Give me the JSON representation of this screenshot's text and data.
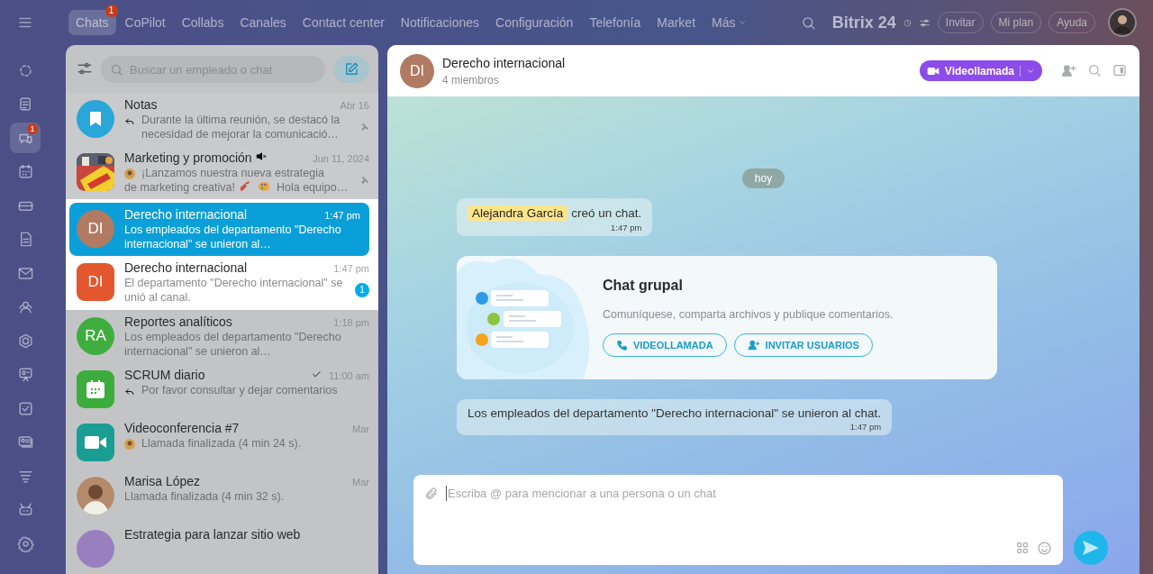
{
  "top_nav": {
    "items": [
      {
        "label": "Chats",
        "selected": true,
        "badge": "1",
        "dropdown": false
      },
      {
        "label": "CoPilot",
        "selected": false,
        "dropdown": false
      },
      {
        "label": "Collabs",
        "selected": false,
        "dropdown": false
      },
      {
        "label": "Canales",
        "selected": false,
        "dropdown": false
      },
      {
        "label": "Contact center",
        "selected": false,
        "dropdown": false
      },
      {
        "label": "Notificaciones",
        "selected": false,
        "dropdown": false
      },
      {
        "label": "Configuración",
        "selected": false,
        "dropdown": false
      },
      {
        "label": "Telefonía",
        "selected": false,
        "dropdown": false
      },
      {
        "label": "Market",
        "selected": false,
        "dropdown": false
      },
      {
        "label": "Más",
        "selected": false,
        "dropdown": true
      }
    ],
    "brand": "Bitrix 24",
    "buttons": [
      "Invitar",
      "Mi plan",
      "Ayuda"
    ]
  },
  "sidebar": {
    "items": [
      {
        "selected": false
      },
      {
        "selected": false
      },
      {
        "selected": true,
        "badge": "1"
      },
      {
        "selected": false
      },
      {
        "selected": false
      },
      {
        "selected": false
      },
      {
        "selected": false
      },
      {
        "selected": false
      },
      {
        "selected": false
      },
      {
        "selected": false
      },
      {
        "selected": false
      },
      {
        "selected": false
      },
      {
        "selected": false
      },
      {
        "selected": false
      },
      {
        "selected": false
      }
    ]
  },
  "chat_list": {
    "search": {
      "placeholder": "Buscar un empleado o chat"
    },
    "sections": [
      {
        "spotlit": false,
        "items": [
          {
            "title": "Notas",
            "time": "Abr 16",
            "preview": "Durante la última reunión, se destacó la necesidad de mejorar la comunicació…",
            "avatar": {
              "kind": "bookmark",
              "color": "#2aa6d9"
            },
            "reply": true,
            "pinned": true,
            "selected": false
          },
          {
            "title": "Marketing y promoción",
            "time": "Jun 11, 2024",
            "preview": "¡Lanzamos nuestra nueva estrategia",
            "preview_2": "de marketing creativa!",
            "preview_tail": "Hola equipo…",
            "sender_avatar": true,
            "pinned": true,
            "muted": true,
            "selected": false
          }
        ]
      },
      {
        "spotlit": true,
        "items": [
          {
            "title": "Derecho internacional",
            "time": "1:47 pm",
            "preview": "Los empleados del departamento \"Derecho internacional\" se unieron al…",
            "avatar": {
              "kind": "initials",
              "initials": "DI",
              "color": "#b07a63"
            },
            "selected": true
          },
          {
            "title": "Derecho internacional",
            "time": "1:47 pm",
            "preview": "El departamento \"Derecho internacional\" se unió al canal.",
            "avatar": {
              "kind": "initials-square",
              "initials": "DI",
              "color": "#e4572e"
            },
            "selected": false,
            "unread": "1"
          }
        ]
      },
      {
        "spotlit": false,
        "items": [
          {
            "title": "Reportes analíticos",
            "time": "1:18 pm",
            "preview": "Los empleados del departamento \"Derecho internacional\" se unieron al…",
            "avatar": {
              "kind": "initials",
              "initials": "RA",
              "color": "#3fae3f"
            },
            "selected": false
          },
          {
            "title": "SCRUM diario",
            "time": "11:00 am",
            "preview": "Por favor consultar y dejar comentarios",
            "avatar": {
              "kind": "calendar",
              "color": "#3cad3c"
            },
            "reply": true,
            "read": true,
            "selected": false
          },
          {
            "title": "Videoconferencia #7",
            "time": "Mar",
            "preview": "Llamada finalizada (4 min 24 s).",
            "avatar": {
              "kind": "video",
              "color": "#1a9e93"
            },
            "sender_avatar": true,
            "selected": false
          },
          {
            "title": "Marisa López",
            "time": "Mar",
            "preview": "Llamada finalizada (4 min 32 s).",
            "selected": false
          },
          {
            "title": "Estrategia para lanzar sitio web",
            "avatar": {
              "kind": "initials",
              "color": "#9a7fc0"
            },
            "selected": false
          }
        ]
      }
    ]
  },
  "chat": {
    "avatar": {
      "initials": "DI",
      "color": "#b07a63"
    },
    "title": "Derecho internacional",
    "subtitle": "4 miembros",
    "call_button": "Videollamada",
    "date": "hoy",
    "messages": [
      {
        "kind": "system",
        "mention": "Alejandra García",
        "text": "creó un chat.",
        "time": "1:47 pm"
      },
      {
        "kind": "card",
        "title": "Chat grupal",
        "text": "Comuníquese, comparta archivos y publique comentarios.",
        "buttons": [
          "VIDEOLLAMADA",
          "INVITAR USUARIOS"
        ]
      },
      {
        "kind": "system",
        "text": "Los empleados del departamento \"Derecho internacional\" se unieron al chat.",
        "time": "1:47 pm"
      }
    ],
    "input": {
      "placeholder": "Escriba @ para mencionar a una persona o un chat"
    }
  }
}
